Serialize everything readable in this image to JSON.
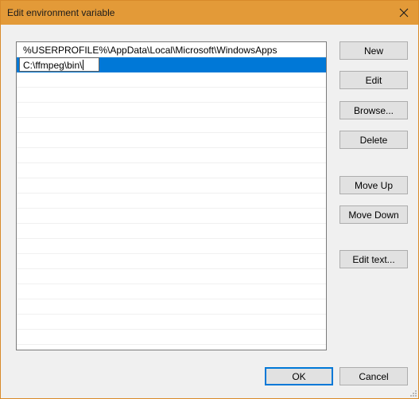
{
  "window": {
    "title": "Edit environment variable",
    "close_icon": "close-icon",
    "accent_color": "#e39a38",
    "selection_color": "#0078d7"
  },
  "list": {
    "items": [
      {
        "value": "%USERPROFILE%\\AppData\\Local\\Microsoft\\WindowsApps",
        "selected": false
      },
      {
        "value": "C:\\ffmpeg\\bin\\",
        "selected": true,
        "editing": true
      }
    ],
    "empty_rows": 18
  },
  "side_buttons": {
    "new": "New",
    "edit": "Edit",
    "browse": "Browse...",
    "delete": "Delete",
    "move_up": "Move Up",
    "move_down": "Move Down",
    "edit_text": "Edit text..."
  },
  "footer": {
    "ok": "OK",
    "cancel": "Cancel"
  }
}
